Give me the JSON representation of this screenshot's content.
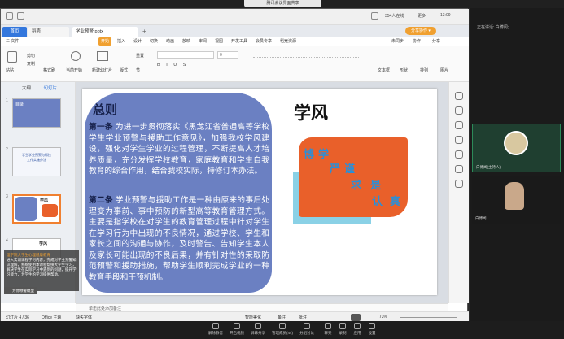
{
  "meeting": {
    "title": "腾讯会议界面共享"
  },
  "wps": {
    "tabs": {
      "home": "首页",
      "daoke": "稻壳",
      "doc": "学业预警.pptx",
      "plus": "+"
    },
    "share_button": "分享协作 ▾",
    "system": {
      "time": "13:09",
      "network": "354人在线",
      "menu_right": "更多"
    },
    "menus": [
      "三 文件",
      "",
      "开始",
      "插入",
      "设计",
      "切换",
      "动画",
      "放映",
      "审阅",
      "视图",
      "开发工具",
      "会员专享",
      "稻壳资源"
    ],
    "menu_right": [
      "未同步",
      "协作",
      "分享"
    ],
    "toolbar": {
      "items": [
        "粘贴",
        "剪切",
        "复制",
        "格式刷",
        "当前开始",
        "新建幻灯片",
        "版式",
        "节",
        "重置"
      ],
      "font_box": "",
      "size_box": "0",
      "right_items": [
        "文本框",
        "形状",
        "排列",
        "图片"
      ]
    },
    "thumbs": {
      "tab_outline": "大纲",
      "tab_slides": "幻灯片",
      "numbers": [
        "1",
        "2",
        "3",
        "4"
      ],
      "slide1_title": "目录",
      "slide2_title": "学生学业预警与帮扶工作实施办法",
      "slide3_title": "学风",
      "slide4_title": "学风"
    },
    "slide": {
      "title": "总则",
      "para1_label": "第一条",
      "para1_text": " 为进一步贯彻落实《黑龙江省普通高等学校学生学业预警与援助工作意见》，加强我校学风建设，强化对学生学业的过程管理，不断提高人才培养质量，充分发挥学校教育，家庭教育和学生自我教育的综合作用，结合我校实际，特修订本办法。",
      "para2_label": "第二条",
      "para2_text": " 学业预警与援助工作是一种由原来的事后处理变为事前、事中预防的新型高等教育管理方式。主要是指学校在对学生的教育管理过程中针对学生在学习行为中出现的不良情况，通过学校、学生和家长之间的沟通与协作，及时警告、告知学生本人及家长可能出现的不良后果，并有针对性的采取防范预警和援助措施，帮助学生顺利完成学业的一种教育手段和干预机制。",
      "xuefeng": "学风",
      "motto": [
        "博",
        "学",
        "严",
        "谨",
        "求",
        "是",
        "认",
        "真"
      ]
    },
    "notes_placeholder": "单击此处添加备注",
    "status": {
      "slide_info": "幻灯片 4 / 36",
      "theme": "Office 主题",
      "missing_font": "缺失字体",
      "smart": "智能美化",
      "notes": "备注",
      "comment": "批注",
      "zoom": "73%"
    }
  },
  "chat": {
    "sender": "理学院大学生心理健康教育",
    "message": "进入实训课程学习内容，完成对学业预警知识理解，熟练使用本课程帮扶大学生学习，解决学生在实际学习中遇到的问题，提升学习能力，为学生的学习提供帮助。",
    "button": "为你预警模型"
  },
  "video": {
    "speaker": "正在讲话: 白博闻;",
    "participant1": "白博闻(主持人)",
    "participant2": "白博闻"
  },
  "bottombar": [
    {
      "label": "解除静音",
      "icon": "mic-icon"
    },
    {
      "label": "开启视频",
      "icon": "camera-icon"
    },
    {
      "label": "屏幕共享",
      "icon": "share-icon"
    },
    {
      "label": "管理成员(44)",
      "icon": "members-icon"
    },
    {
      "label": "分组讨论",
      "icon": "group-icon"
    },
    {
      "label": "聊天",
      "icon": "chat-icon"
    },
    {
      "label": "录制",
      "icon": "record-icon"
    },
    {
      "label": "应用",
      "icon": "apps-icon"
    },
    {
      "label": "设置",
      "icon": "settings-icon"
    }
  ]
}
